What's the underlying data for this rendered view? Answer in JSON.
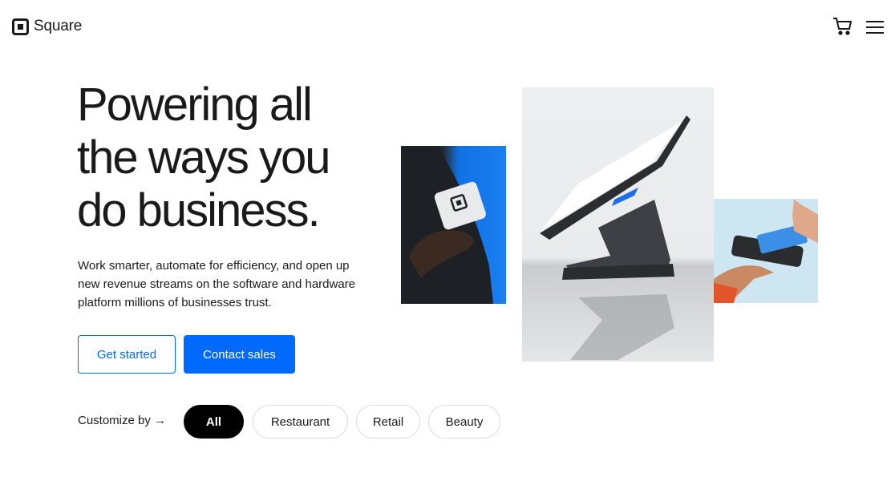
{
  "header": {
    "brand": "Square",
    "icons": [
      "square-logo-icon",
      "cart-icon",
      "menu-icon"
    ]
  },
  "hero": {
    "headline_lines": [
      "Powering all",
      "the ways you",
      "do business."
    ],
    "subtext": "Work smarter, automate for efficiency, and open up new revenue streams on the software and hardware platform millions of businesses trust.",
    "primary_cta": "Get started",
    "secondary_cta": "Contact sales"
  },
  "customize": {
    "label": "Customize by →",
    "options": [
      {
        "label": "All",
        "active": true
      },
      {
        "label": "Restaurant",
        "active": false
      },
      {
        "label": "Retail",
        "active": false
      },
      {
        "label": "Beauty",
        "active": false
      }
    ]
  },
  "images": [
    {
      "alt": "Hand holding Square reader on blue background"
    },
    {
      "alt": "Square Register tablet on stand"
    },
    {
      "alt": "Card tapped on phone for payment"
    }
  ],
  "colors": {
    "accent": "#006aff",
    "text": "#1a1a1a",
    "pill_active": "#000000"
  }
}
